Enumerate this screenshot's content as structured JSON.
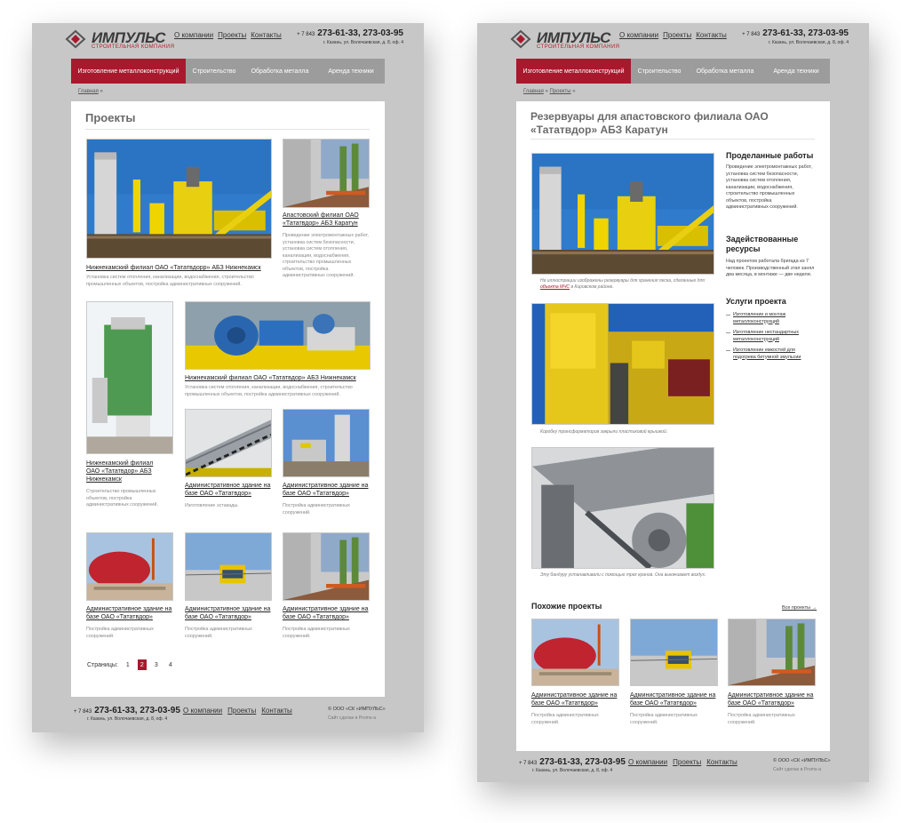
{
  "brand": {
    "name": "ИМПУЛЬС",
    "tagline": "СТРОИТЕЛЬНАЯ КОМПАНИЯ"
  },
  "header_nav": [
    "О компании",
    "Проекты",
    "Контакты"
  ],
  "contact": {
    "code": "+ 7 843",
    "phones": "273-61-33, 273-03-95",
    "address": "г. Казань, ул. Волочаевская, д. 8, оф. 4"
  },
  "menu": [
    "Изготовление металлоконструкций",
    "Строительство",
    "Обработка металла",
    "Аренда техники"
  ],
  "colors": {
    "accent": "#a8192e",
    "menu": "#9c9c9c",
    "frame": "#c7c7c7"
  },
  "page1": {
    "breadcrumb": "Главная",
    "breadcrumb_sep": "»",
    "title": "Проекты",
    "projects": [
      {
        "caption": "Нижнекамский филиал ОАО «Тататвдорр» АБЗ Нижнекамск",
        "desc": "Установка систем отопления, канализации, водоснабжения, строительство промышленных объектов, постройка административных сооружений."
      },
      {
        "caption": "Апастовский филиал ОАО «Тататвдор» АБЗ Каратун",
        "desc": "Проведение электромонтажных работ, установка систем безопасности, установка систем отопления, канализации, водоснабжения, строительство промышленных объектов, постройка административных сооружений."
      },
      {
        "caption": "Нижнекамский филиал ОАО «Тататвдор» АБЗ Нижнекамск",
        "desc": "Строительство промышленных объектов, постройка административных сооружений."
      },
      {
        "caption": "Нижнекамский филиал ОАО «Тататвдор» АБЗ Нижнекамск",
        "desc": "Установка систем отопления, канализации, водоснабжения, строительство промышленных объектов, постройка административных сооружений."
      },
      {
        "caption": "Административное здание на базе ОАО «Тататвдор»",
        "desc": "Изготовление эстакады."
      },
      {
        "caption": "Административное здание на базе ОАО «Тататвдор»",
        "desc": "Постройка административных сооружений."
      },
      {
        "caption": "Административное здание на базе ОАО «Тататвдор»",
        "desc": "Постройка административных сооружений."
      },
      {
        "caption": "Административное здание на базе ОАО «Тататвдор»",
        "desc": "Постройка административных сооружений."
      },
      {
        "caption": "Административное здание на базе ОАО «Тататвдор»",
        "desc": "Постройка административных сооружений."
      }
    ],
    "pagination": {
      "label": "Страницы:",
      "pages": [
        "1",
        "2",
        "3",
        "4"
      ],
      "current": "2"
    }
  },
  "page2": {
    "breadcrumb": [
      "Главная",
      "Проекты"
    ],
    "breadcrumb_sep": "»",
    "title": "Резервуары для апастовского филиала ОАО «Тататвдор» АБЗ Каратун",
    "photo_notes": {
      "n1_pre": "На иллюстрации изображены резервуары для хранения песка, сделанные для",
      "n1_link": "объекта МЧС",
      "n1_post": "в Кировском районе.",
      "n2": "Коробку трансформаторов закрыли пластиковой крышкой.",
      "n3": "Эту бандуру устанавливали с помощью трех кранов. Она выкачивает воздух."
    },
    "works_title": "Проделанные работы",
    "works_text": "Проведение электромонтажных работ, установка систем безопасности, установка систем отопления, канализации, водоснабжения, строительство промышленных объектов, постройка административных сооружений.",
    "resources_title": "Задействованные ресурсы",
    "resources_text": "Над проектом работала бригада из 7 человек. Производственный этап занял два месяца, в монтаже — две недели.",
    "services_title": "Услуги проекта",
    "services": [
      "Изготовление и монтаж металлоконструкций",
      "Изготовление нестандартных металлоконструкций",
      "Изготовление емкостей для подогрева битумной эмульсии"
    ],
    "similar_title": "Похожие проекты",
    "all_projects": "Все проекты →",
    "similar": [
      {
        "caption": "Административное здание на базе ОАО «Тататвдор»",
        "desc": "Постройка административных сооружений."
      },
      {
        "caption": "Административное здание на базе ОАО «Тататвдор»",
        "desc": "Постройка административных сооружений."
      },
      {
        "caption": "Административное здание на базе ОАО «Тататвдор»",
        "desc": "Постройка административных сооружений."
      }
    ]
  },
  "footer": {
    "copyright": "© ООО «СК «ИМПУЛЬС»",
    "made": "Сайт сделан в Promo-a"
  }
}
